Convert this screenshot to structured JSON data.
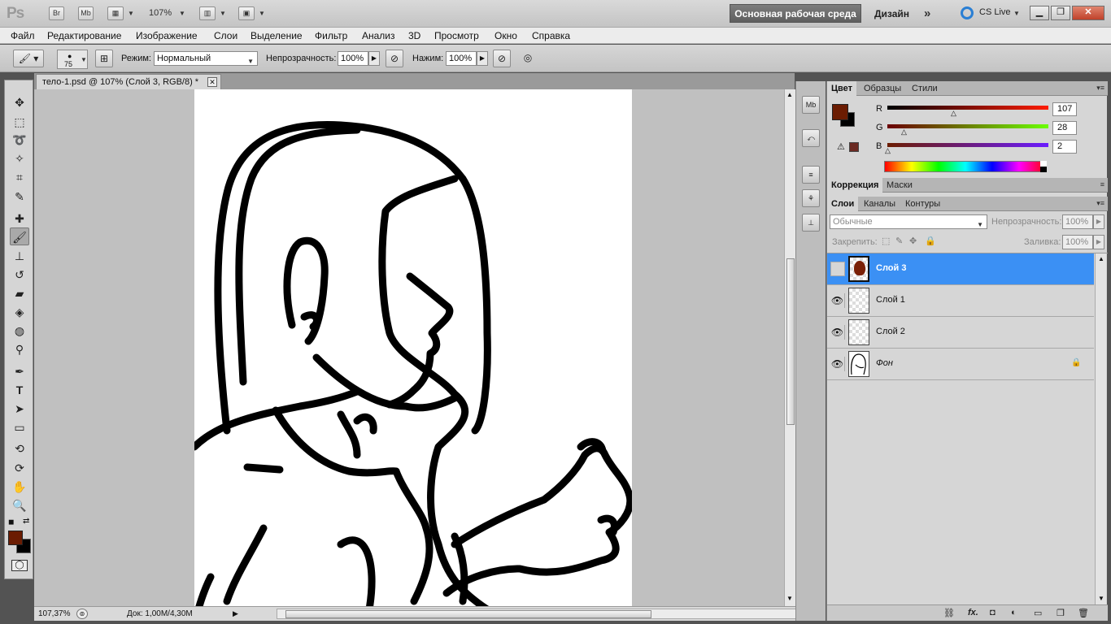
{
  "app": {
    "logo": "Ps",
    "bridge_btn": "Br",
    "mini_bridge_btn": "Mb",
    "zoom": "107%",
    "workspace_active": "Основная рабочая среда",
    "workspace_alt": "Дизайн",
    "more": "»",
    "cs_live": "CS Live"
  },
  "menu": [
    "Файл",
    "Редактирование",
    "Изображение",
    "Слои",
    "Выделение",
    "Фильтр",
    "Анализ",
    "3D",
    "Просмотр",
    "Окно",
    "Справка"
  ],
  "options": {
    "brush_size": "75",
    "mode_label": "Режим:",
    "mode_value": "Нормальный",
    "opacity_label": "Непрозрачность:",
    "opacity_value": "100%",
    "flow_label": "Нажим:",
    "flow_value": "100%"
  },
  "document": {
    "tab_title": "тело-1.psd @ 107% (Слой 3, RGB/8) *",
    "close": "✕",
    "zoom_status": "107,37%",
    "doc_info": "Док: 1,00M/4,30M"
  },
  "colors": {
    "foreground": "#6b1c02",
    "background": "#000000",
    "selection": "#3b90f4"
  },
  "color_panel": {
    "tabs": [
      "Цвет",
      "Образцы",
      "Стили"
    ],
    "r_label": "R",
    "g_label": "G",
    "b_label": "B",
    "r_value": "107",
    "g_value": "28",
    "b_value": "2"
  },
  "adjust_panel": {
    "tabs": [
      "Коррекция",
      "Маски"
    ]
  },
  "layers_panel": {
    "tabs": [
      "Слои",
      "Каналы",
      "Контуры"
    ],
    "blend_mode": "Обычные",
    "opacity_label": "Непрозрачность:",
    "opacity_value": "100%",
    "lock_label": "Закрепить:",
    "fill_label": "Заливка:",
    "fill_value": "100%",
    "layers": [
      {
        "name": "Слой 3",
        "selected": true,
        "visible": false
      },
      {
        "name": "Слой 1",
        "selected": false,
        "visible": true
      },
      {
        "name": "Слой 2",
        "selected": false,
        "visible": true
      },
      {
        "name": "Фон",
        "selected": false,
        "visible": true
      }
    ]
  },
  "icons": {
    "eye": "eye-icon",
    "lock": "lock-icon",
    "link": "link-icon",
    "fx": "fx-icon",
    "mask": "mask-icon",
    "adjust": "adjustment-icon",
    "folder": "folder-icon",
    "new_layer": "new-layer-icon",
    "trash": "trash-icon"
  }
}
